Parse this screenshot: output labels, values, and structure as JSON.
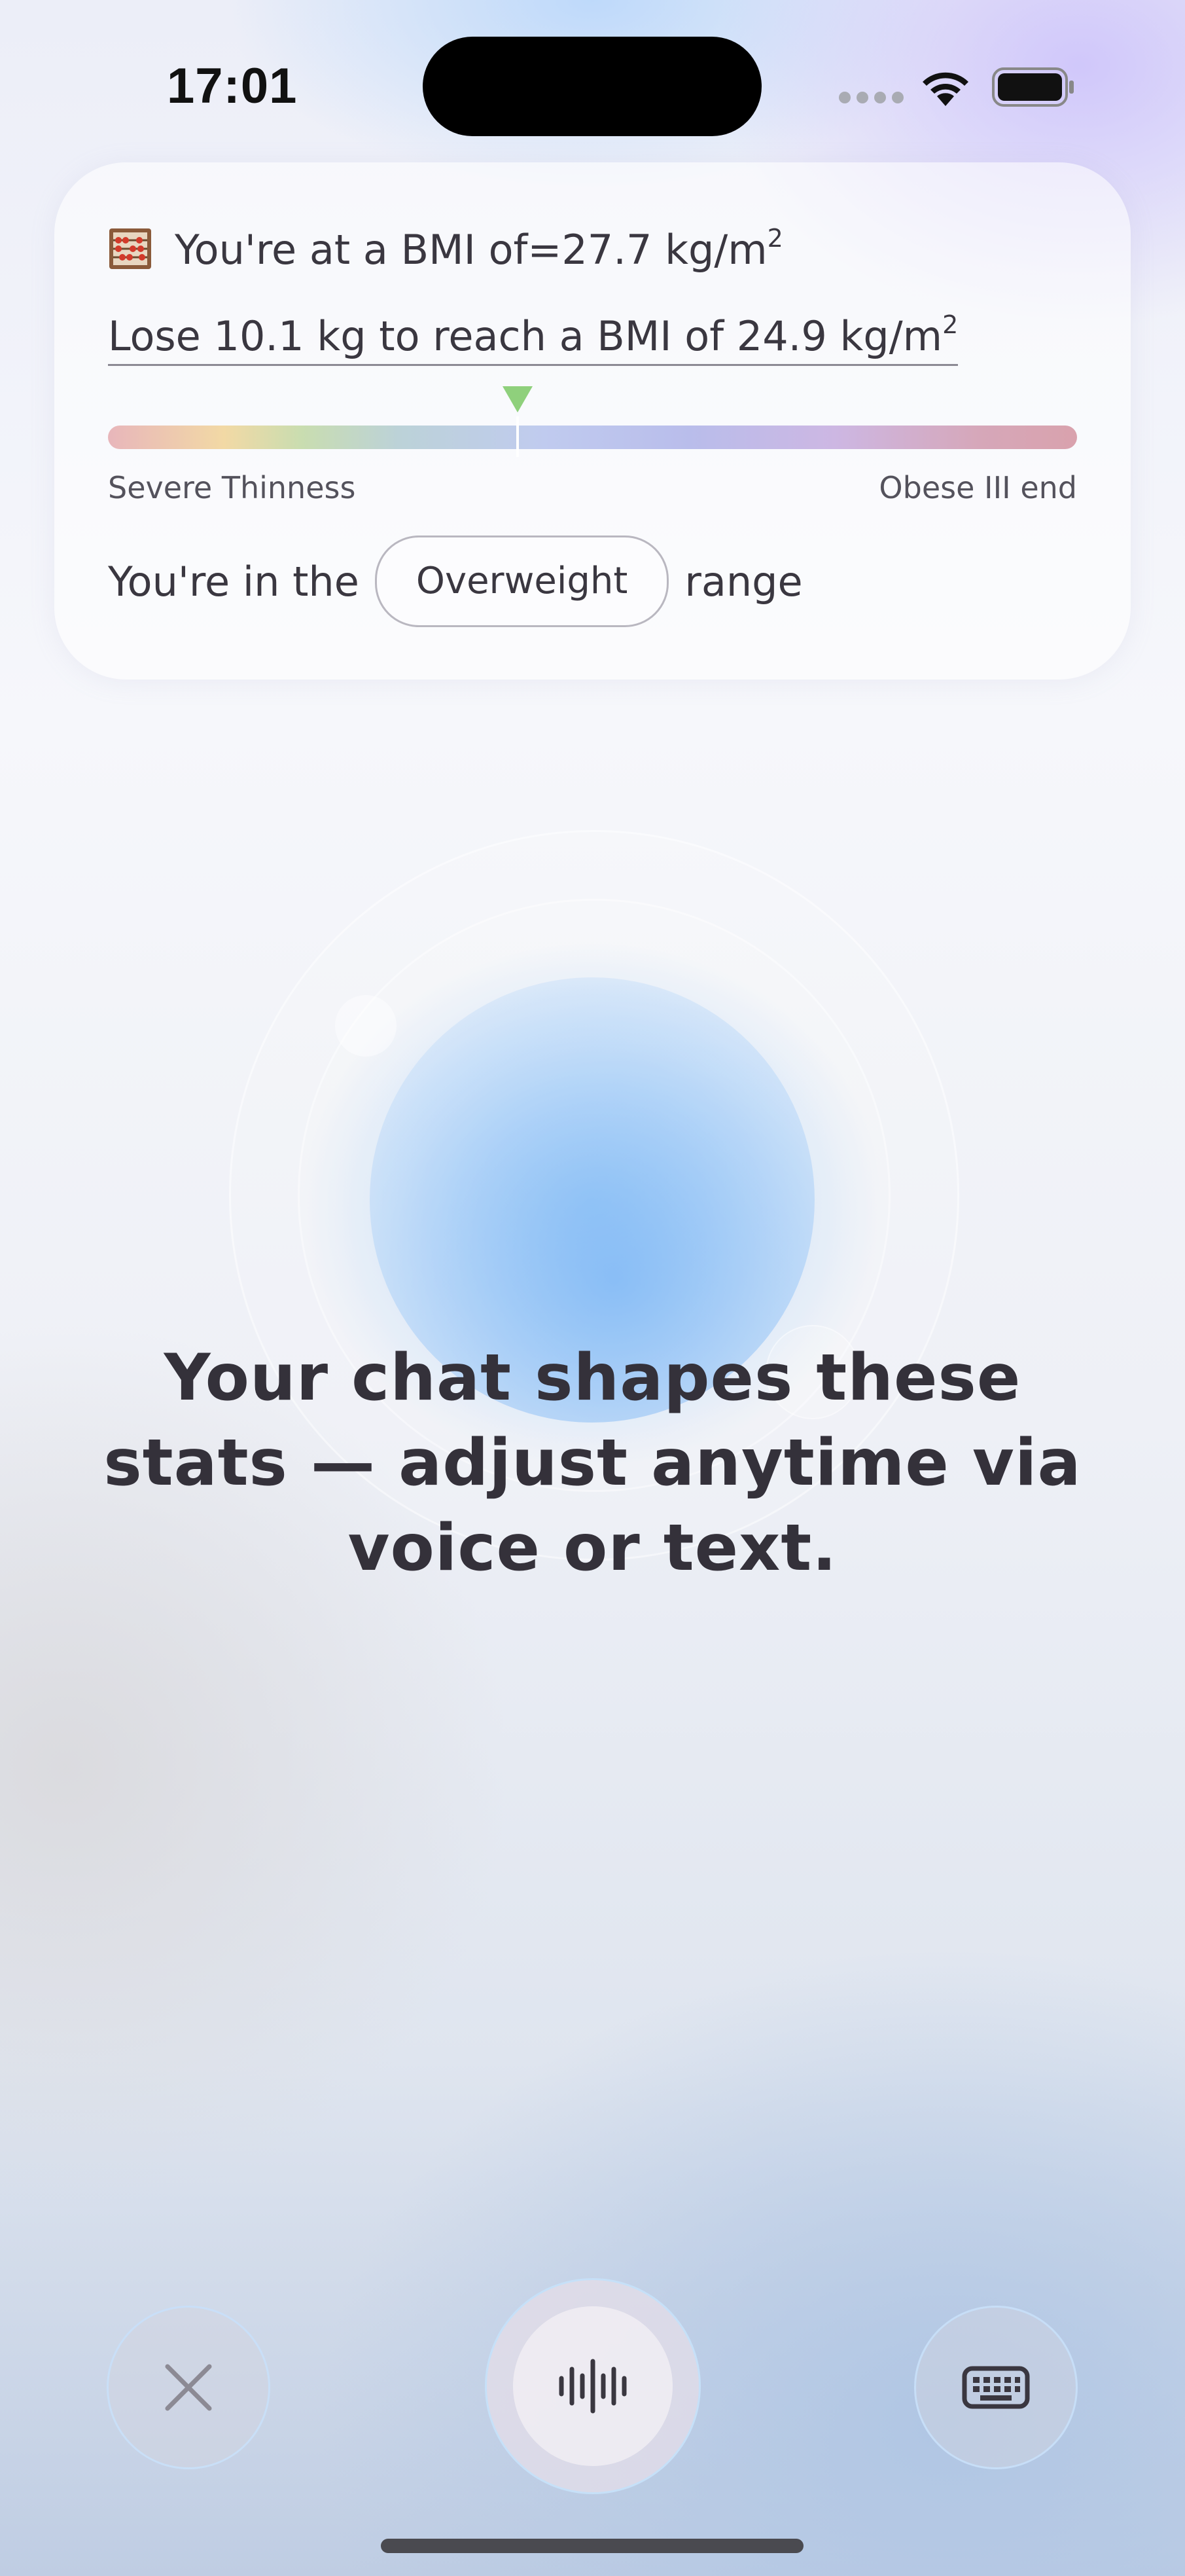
{
  "status_bar": {
    "time": "17:01",
    "icons": [
      "signal-dots-icon",
      "wifi-icon",
      "battery-icon"
    ]
  },
  "bmi_card": {
    "icon": "abacus-icon",
    "current_bmi_prefix": "You're at a BMI of=",
    "current_bmi_value": "27.7 kg/m",
    "current_bmi_exp": "2",
    "goal_text": "Lose 10.1 kg to reach a BMI of 24.9 kg/m",
    "goal_exp": "2",
    "scale_min_label": "Severe Thinness",
    "scale_max_label": "Obese III end",
    "marker_fraction": 0.423,
    "range_prefix": "You're in the",
    "range_label": "Overweight",
    "range_suffix": "range",
    "marker_color": "#8fd07c"
  },
  "headline": "Your chat shapes these stats — adjust anytime via voice or text.",
  "controls": {
    "close_icon": "close-icon",
    "voice_icon": "voice-waveform-icon",
    "keyboard_icon": "keyboard-icon"
  }
}
